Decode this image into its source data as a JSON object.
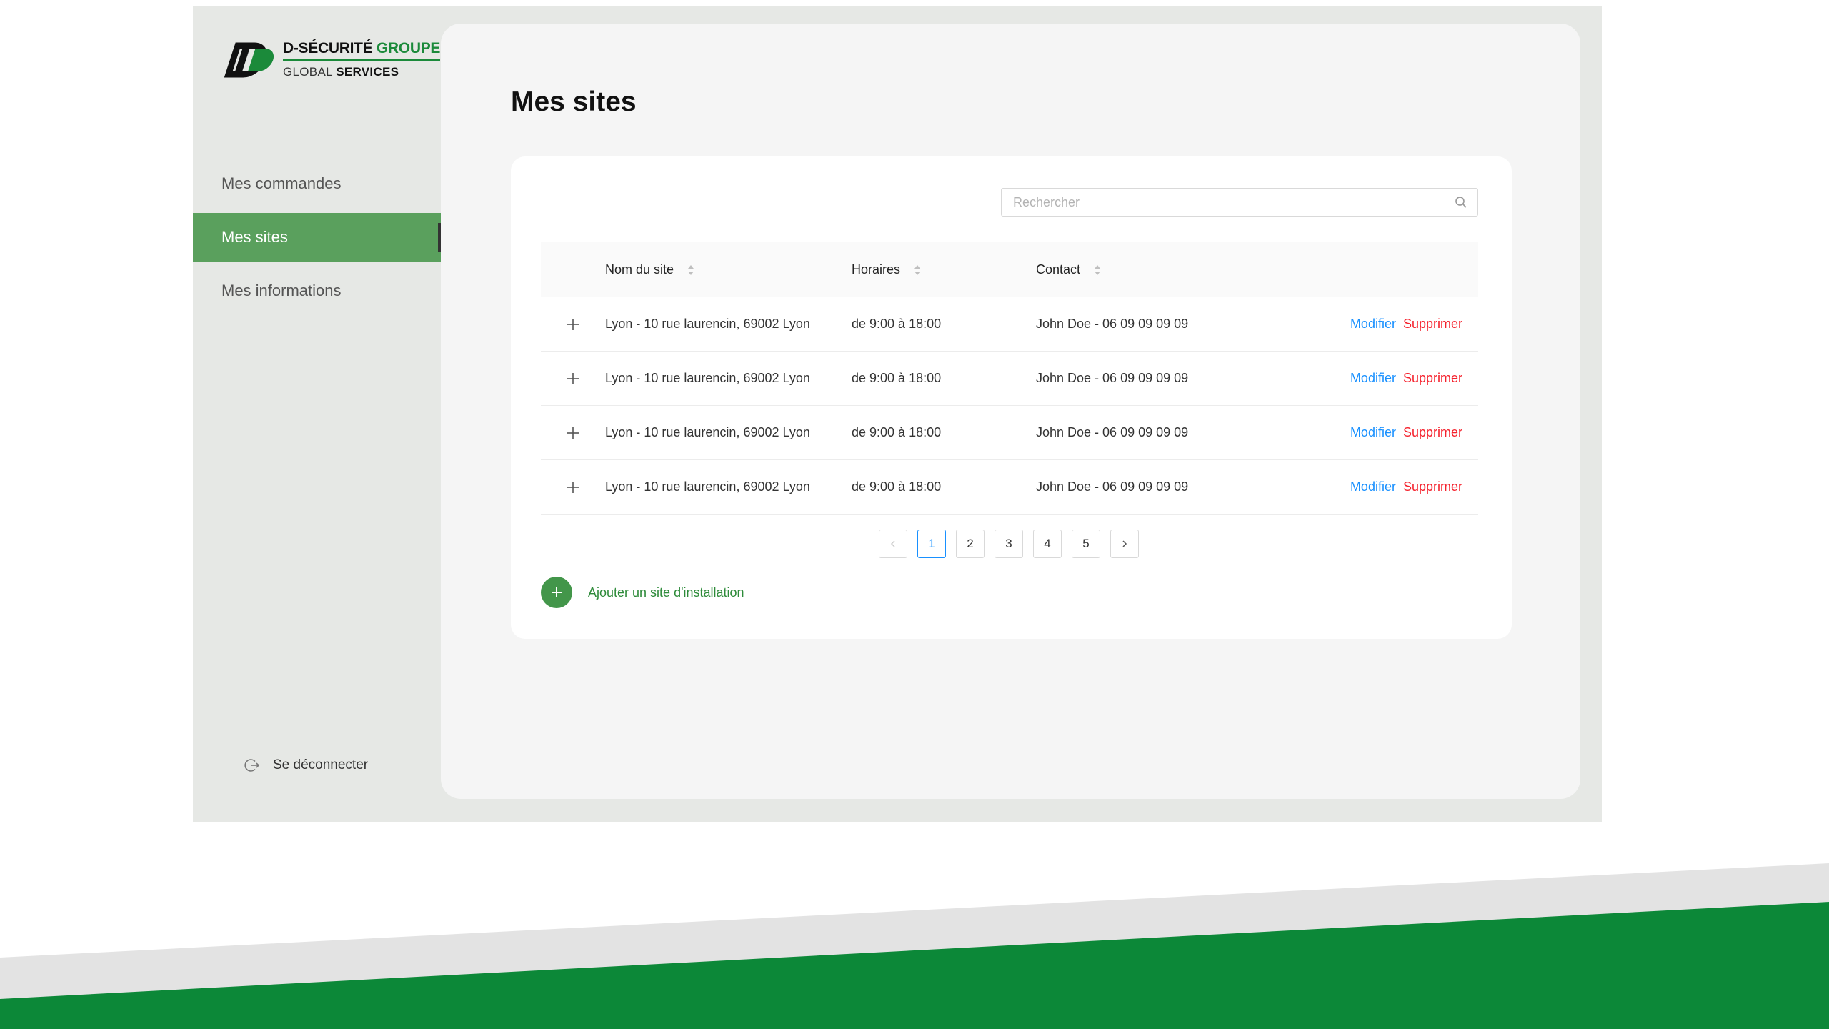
{
  "brand": {
    "line1_main": "D-SÉCURITÉ",
    "line1_accent": "GROUPE",
    "line2_main": "GLOBAL",
    "line2_bold": "SERVICES",
    "colors": {
      "green": "#1b8a3a",
      "sidebar_active": "#5aa05d",
      "bottom_stripe": "#0c8838"
    }
  },
  "sidebar": {
    "items": [
      {
        "label": "Mes commandes",
        "active": false
      },
      {
        "label": "Mes sites",
        "active": true
      },
      {
        "label": "Mes informations",
        "active": false
      }
    ],
    "logout_label": "Se déconnecter"
  },
  "main": {
    "title": "Mes sites",
    "search": {
      "placeholder": "Rechercher",
      "value": ""
    },
    "table": {
      "headers": {
        "name": "Nom du site",
        "hours": "Horaires",
        "contact": "Contact"
      },
      "rows": [
        {
          "name": "Lyon - 10 rue laurencin, 69002 Lyon",
          "hours": "de 9:00 à 18:00",
          "contact": "John Doe - 06 09 09 09 09",
          "edit": "Modifier",
          "delete": "Supprimer"
        },
        {
          "name": "Lyon - 10 rue laurencin, 69002 Lyon",
          "hours": "de 9:00 à 18:00",
          "contact": "John Doe - 06 09 09 09 09",
          "edit": "Modifier",
          "delete": "Supprimer"
        },
        {
          "name": "Lyon - 10 rue laurencin, 69002 Lyon",
          "hours": "de 9:00 à 18:00",
          "contact": "John Doe - 06 09 09 09 09",
          "edit": "Modifier",
          "delete": "Supprimer"
        },
        {
          "name": "Lyon - 10 rue laurencin, 69002 Lyon",
          "hours": "de 9:00 à 18:00",
          "contact": "John Doe - 06 09 09 09 09",
          "edit": "Modifier",
          "delete": "Supprimer"
        }
      ]
    },
    "pagination": {
      "pages": [
        "1",
        "2",
        "3",
        "4",
        "5"
      ],
      "current": "1"
    },
    "add_label": "Ajouter un site d'installation"
  }
}
